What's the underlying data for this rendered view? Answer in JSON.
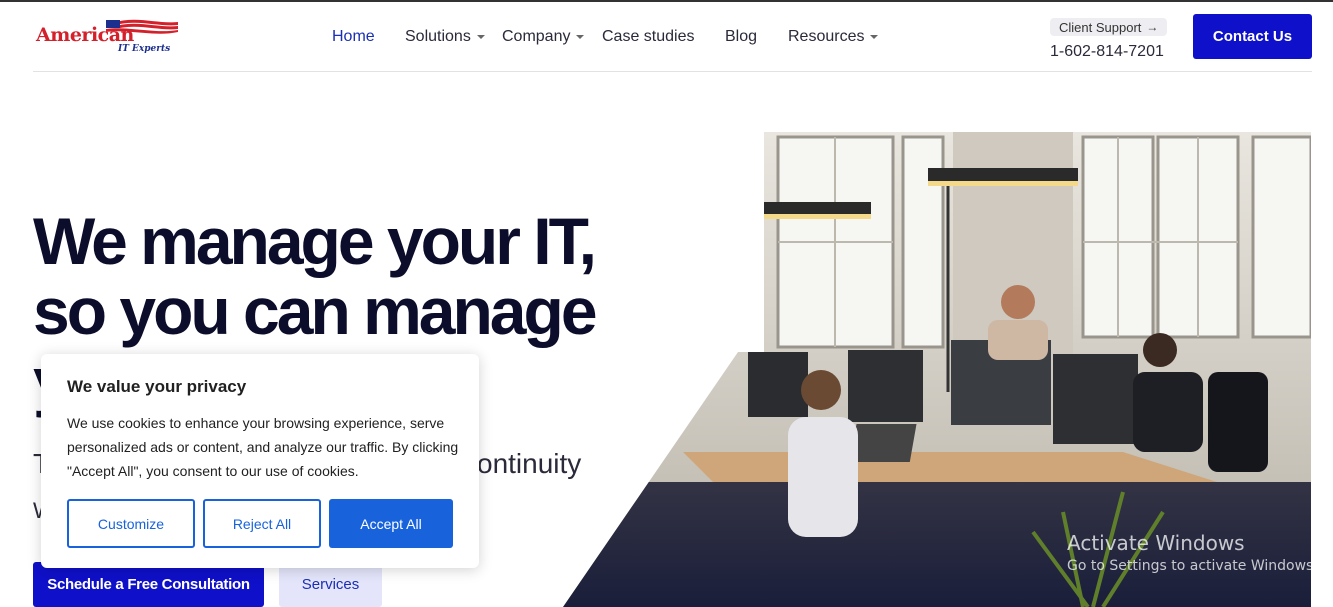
{
  "brand": {
    "name": "American",
    "tagline": "IT Experts"
  },
  "nav": {
    "items": [
      {
        "label": "Home",
        "active": true,
        "dropdown": false
      },
      {
        "label": "Solutions",
        "active": false,
        "dropdown": true
      },
      {
        "label": "Company",
        "active": false,
        "dropdown": true
      },
      {
        "label": "Case studies",
        "active": false,
        "dropdown": false
      },
      {
        "label": "Blog",
        "active": false,
        "dropdown": false
      },
      {
        "label": "Resources",
        "active": false,
        "dropdown": true
      }
    ]
  },
  "header": {
    "support_label": "Client Support",
    "support_icon": "arrow-right-icon",
    "phone": "1-602-814-7201",
    "contact_label": "Contact Us"
  },
  "hero": {
    "title_line1": "We manage your IT,",
    "title_line2": "so you can manage",
    "title_line3": "y",
    "subtitle_start": "T",
    "subtitle_end": "ontinuity",
    "subtitle2_start": "W",
    "primary_cta": "Schedule a Free Consultation",
    "secondary_cta": "Services"
  },
  "cookie": {
    "title": "We value your privacy",
    "text": "We use cookies to enhance your browsing experience, serve personalized ads or content, and analyze our traffic. By clicking \"Accept All\", you consent to our use of cookies.",
    "customize": "Customize",
    "reject": "Reject All",
    "accept": "Accept All"
  },
  "watermark": {
    "line1": "Activate Windows",
    "line2": "Go to Settings to activate Windows."
  },
  "colors": {
    "primary": "#0f10c9",
    "nav_active": "#1a2fb3",
    "cookie_accent": "#1863dc",
    "heading": "#0c0d2a",
    "logo_red": "#d4202a",
    "logo_blue": "#1c2f8f"
  }
}
